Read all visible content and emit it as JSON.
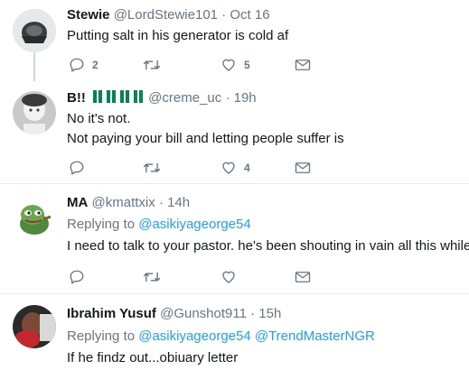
{
  "tweets": [
    {
      "name": "Stewie",
      "handle": "@LordStewie101",
      "dot": "·",
      "time": "Oct 16",
      "lines": [
        "Putting salt in his generator is cold af"
      ],
      "reply_count": "2",
      "like_count": "5"
    },
    {
      "name": "B!!",
      "handle": "@creme_uc",
      "dot": "·",
      "time": "19h",
      "lines": [
        "No it's not.",
        "Not paying your bill and letting people suffer is"
      ],
      "reply_count": "",
      "like_count": "4"
    },
    {
      "name": "MA",
      "handle": "@kmattxix",
      "dot": "·",
      "time": "14h",
      "replying_prefix": "Replying to",
      "replying_to": "@asikiyageorge54",
      "lines": [
        "I need to talk to your pastor. he's been shouting in vain all this while."
      ],
      "reply_count": "",
      "like_count": ""
    },
    {
      "name": "Ibrahim Yusuf",
      "handle": "@Gunshot911",
      "dot": "·",
      "time": "15h",
      "replying_prefix": "Replying to",
      "replying_to": "@asikiyageorge54 @TrendMasterNGR",
      "lines": [
        "If he findz out...obiuary letter"
      ]
    }
  ],
  "icons": {
    "reply": "reply-icon",
    "retweet": "retweet-icon",
    "like": "heart-icon",
    "dm": "envelope-icon"
  },
  "colors": {
    "text": "#14171a",
    "muted": "#657786",
    "link": "#1da1f2",
    "border": "#e6ecf0",
    "thread": "#ccd6dd",
    "flag_green": "#008751"
  }
}
